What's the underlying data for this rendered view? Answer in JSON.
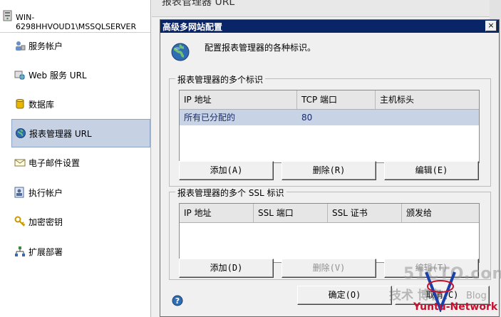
{
  "sidebar": {
    "server_name": "WIN-6298HHVOUD1\\MSSQLSERVER",
    "items": [
      {
        "label": "服务帐户",
        "icon": "service-account-icon"
      },
      {
        "label": "Web 服务 URL",
        "icon": "web-service-icon"
      },
      {
        "label": "数据库",
        "icon": "database-icon"
      },
      {
        "label": "报表管理器 URL",
        "icon": "globe-icon",
        "selected": true
      },
      {
        "label": "电子邮件设置",
        "icon": "email-icon"
      },
      {
        "label": "执行帐户",
        "icon": "execution-account-icon"
      },
      {
        "label": "加密密钥",
        "icon": "key-icon"
      },
      {
        "label": "扩展部署",
        "icon": "network-icon"
      }
    ]
  },
  "main": {
    "title": "报表管理器 URL"
  },
  "dialog": {
    "title": "高级多网站配置",
    "close_label": "×",
    "intro": "配置报表管理器的各种标识。",
    "identities": {
      "legend": "报表管理器的多个标识",
      "columns": [
        "IP 地址",
        "TCP 端口",
        "主机标头"
      ],
      "rows": [
        {
          "ip": "所有已分配的",
          "port": "80",
          "host": ""
        }
      ],
      "add_label": "添加(A)",
      "delete_label": "删除(R)",
      "edit_label": "编辑(E)"
    },
    "ssl": {
      "legend": "报表管理器的多个 SSL 标识",
      "columns": [
        "IP 地址",
        "SSL 端口",
        "SSL 证书",
        "颁发给"
      ],
      "add_label": "添加(D)",
      "delete_label": "删除(V)",
      "edit_label": "编辑(T)"
    },
    "ok_label": "确定(O)",
    "cancel_label": "取消(C)"
  },
  "watermark": {
    "line1": "51CTO.com",
    "line2": "技术 博客",
    "blog": "Blog",
    "line3": "Yuntu-Network"
  },
  "colors": {
    "dialog_titlebar": "#0a2468",
    "selected_row": "#c8d3e6",
    "nav_selected": "#c6d2e3"
  }
}
